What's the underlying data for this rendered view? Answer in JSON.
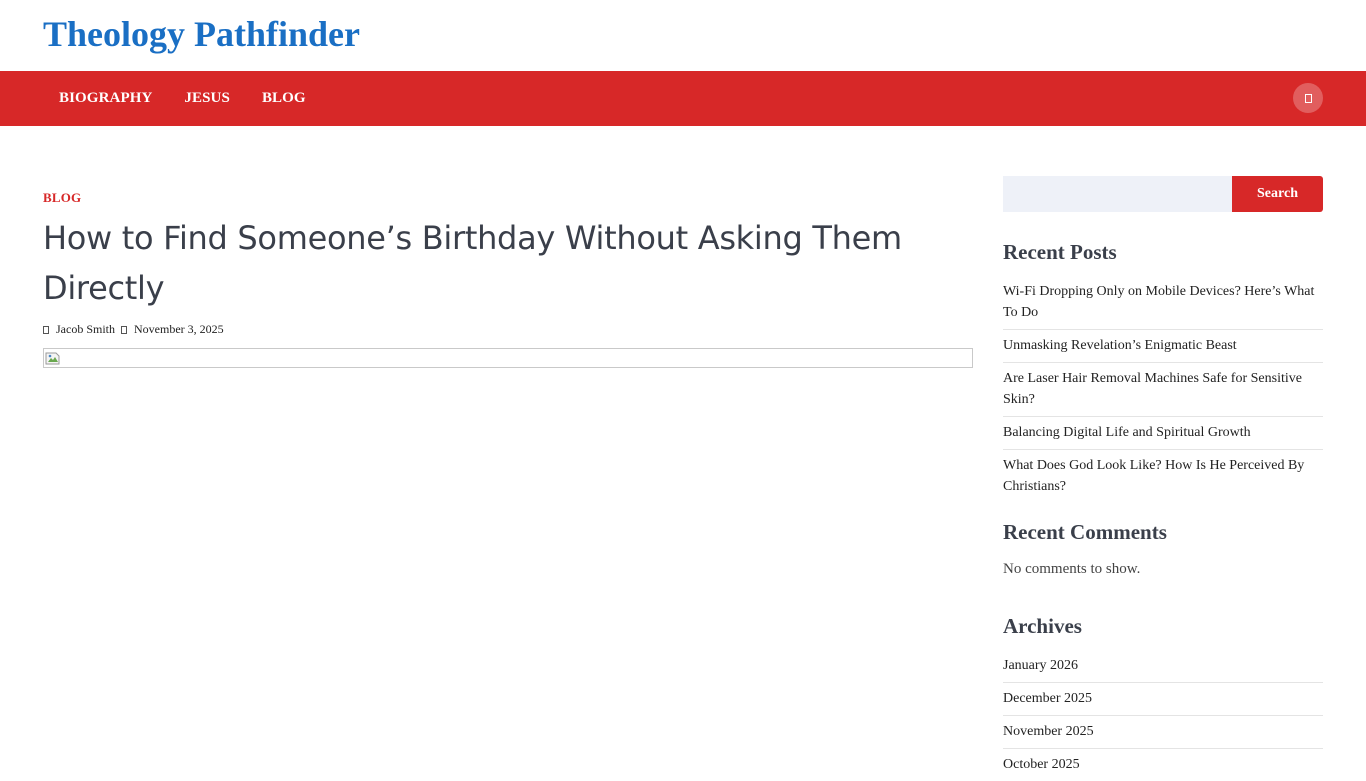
{
  "site": {
    "title": "Theology Pathfinder"
  },
  "nav": {
    "items": [
      {
        "label": "BIOGRAPHY"
      },
      {
        "label": "JESUS"
      },
      {
        "label": "BLOG"
      }
    ],
    "search_icon": "search-icon"
  },
  "post": {
    "category": "BLOG",
    "title": "How to Find Someone’s Birthday Without Asking Them Directly",
    "author": "Jacob Smith",
    "date": "November 3, 2025",
    "author_icon": "user-icon",
    "date_icon": "calendar-icon"
  },
  "sidebar": {
    "search": {
      "placeholder": "",
      "button_label": "Search"
    },
    "recent_posts": {
      "title": "Recent Posts",
      "items": [
        {
          "label": "Wi-Fi Dropping Only on Mobile Devices? Here’s What To Do"
        },
        {
          "label": "Unmasking Revelation’s Enigmatic Beast"
        },
        {
          "label": "Are Laser Hair Removal Machines Safe for Sensitive Skin?"
        },
        {
          "label": "Balancing Digital Life and Spiritual Growth"
        },
        {
          "label": "What Does God Look Like? How Is He Perceived By Christians?"
        }
      ]
    },
    "recent_comments": {
      "title": "Recent Comments",
      "empty_text": "No comments to show."
    },
    "archives": {
      "title": "Archives",
      "items": [
        {
          "label": "January 2026"
        },
        {
          "label": "December 2025"
        },
        {
          "label": "November 2025"
        },
        {
          "label": "October 2025"
        }
      ]
    }
  },
  "colors": {
    "brand_blue": "#1a6fc4",
    "nav_red": "#d72828",
    "search_field_bg": "#eef1f8"
  }
}
